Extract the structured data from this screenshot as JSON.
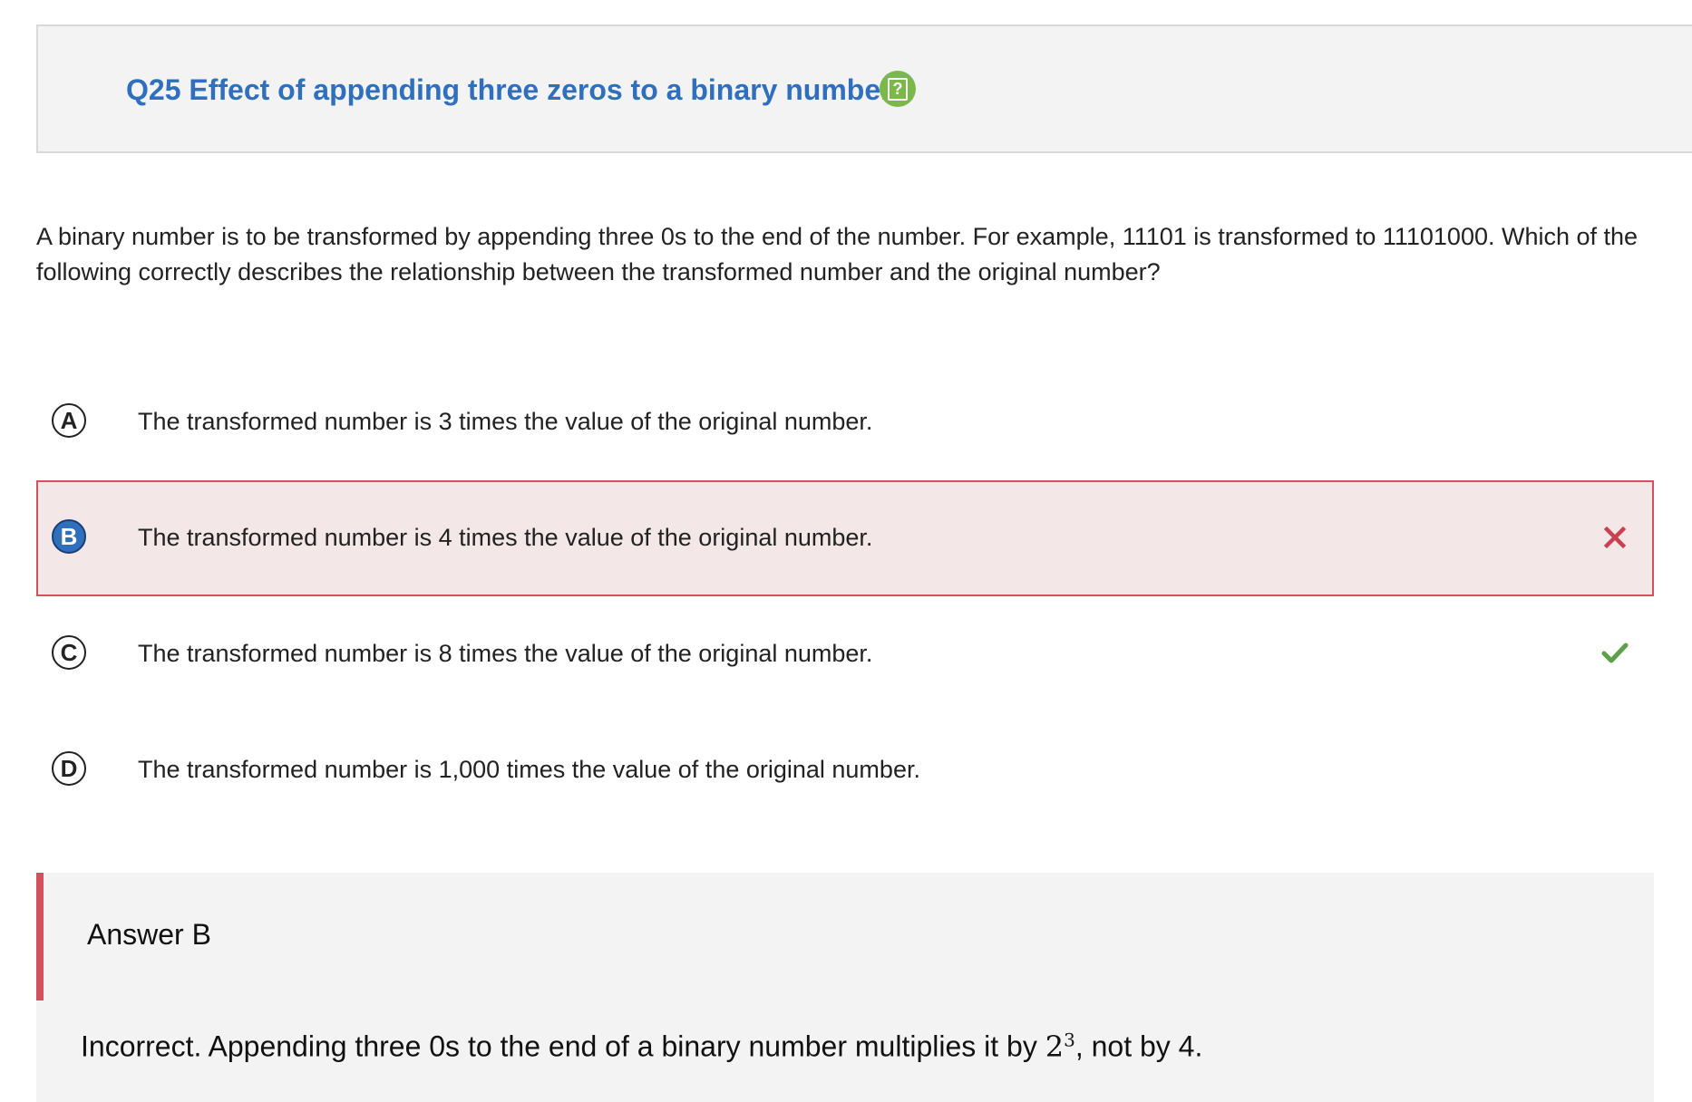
{
  "header": {
    "title": "Q25 Effect of appending three zeros to a binary number",
    "help_icon": "question-mark-icon",
    "help_glyph": "?",
    "accent_color": "#2f6fbe",
    "icon_color": "#7bb84a"
  },
  "question": {
    "text": "A binary number is to be transformed by appending three 0s to the end of the number. For example, 11101 is transformed to 11101000. Which of the following correctly describes the relationship between the transformed number and the original number?"
  },
  "options": [
    {
      "letter": "A",
      "text": "The transformed number is 3 times the value of the original number.",
      "selected": false,
      "status": "none"
    },
    {
      "letter": "B",
      "text": "The transformed number is 4 times the value of the original number.",
      "selected": true,
      "status": "incorrect",
      "icon": "x-icon"
    },
    {
      "letter": "C",
      "text": "The transformed number is 8 times the value of the original number.",
      "selected": false,
      "status": "correct",
      "icon": "check-icon"
    },
    {
      "letter": "D",
      "text": "The transformed number is 1,000 times the value of the original number.",
      "selected": false,
      "status": "none"
    }
  ],
  "colors": {
    "incorrect": "#d4505f",
    "incorrect_fill": "#f4e7e7",
    "correct": "#5ca04a",
    "selected_letter_bg": "#2f6fbe"
  },
  "feedback": {
    "answer_label": "Answer B",
    "text_before": "Incorrect. Appending three 0s to the end of a binary number multiplies it by ",
    "math_base": "2",
    "math_exp": "3",
    "text_after": ", not by 4."
  }
}
